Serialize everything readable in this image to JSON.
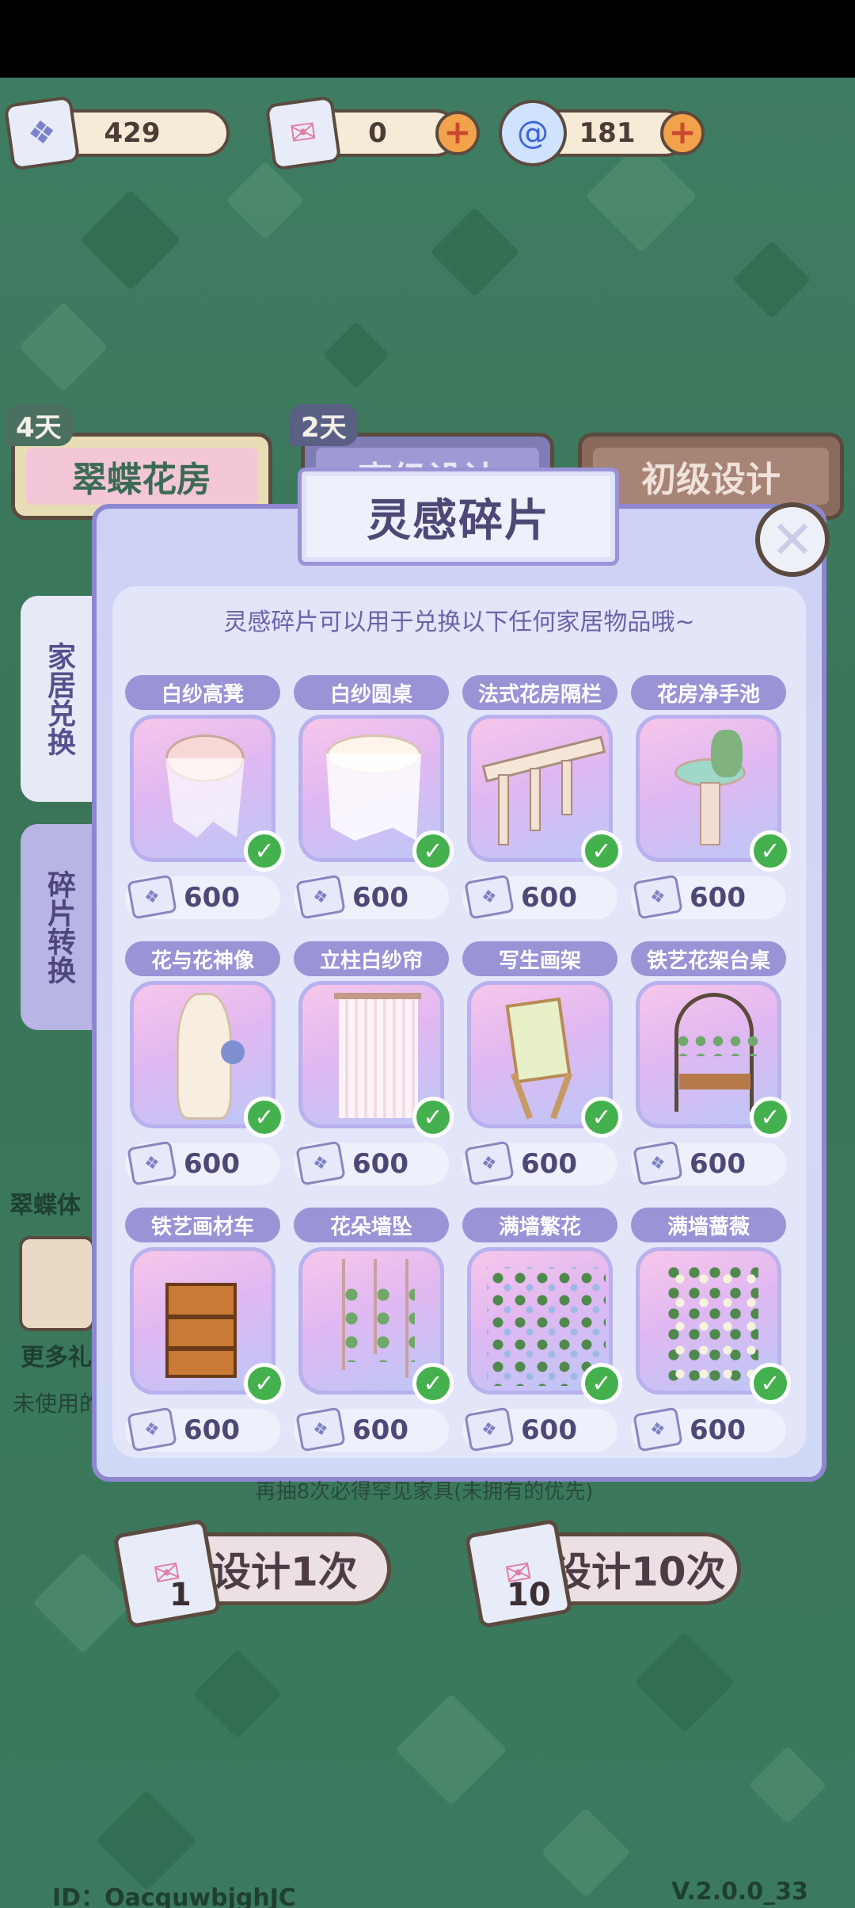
{
  "currencies": [
    {
      "name": "inspiration-fragments",
      "value": "429",
      "icon": "fragment-icon"
    },
    {
      "name": "design-tickets",
      "value": "0",
      "icon": "ticket-icon"
    },
    {
      "name": "swirl-coins",
      "value": "181",
      "icon": "swirl-icon"
    }
  ],
  "tabs": [
    {
      "label": "翠蝶花房",
      "tag": "4天"
    },
    {
      "label": "高级设计",
      "tag": "2天"
    },
    {
      "label": "初级设计"
    }
  ],
  "side_tabs": [
    {
      "label": "家居兑换"
    },
    {
      "label": "碎片转换"
    }
  ],
  "background_partial": {
    "left_label": "翠蝶体",
    "more": "更多礼",
    "unused": "未使用的"
  },
  "modal": {
    "title": "灵感碎片",
    "subtitle": "灵感碎片可以用于兑换以下任何家居物品哦~",
    "items": [
      {
        "name": "白纱高凳",
        "price": "600",
        "owned": true
      },
      {
        "name": "白纱圆桌",
        "price": "600",
        "owned": true
      },
      {
        "name": "法式花房隔栏",
        "price": "600",
        "owned": true
      },
      {
        "name": "花房净手池",
        "price": "600",
        "owned": true
      },
      {
        "name": "花与花神像",
        "price": "600",
        "owned": true
      },
      {
        "name": "立柱白纱帘",
        "price": "600",
        "owned": true
      },
      {
        "name": "写生画架",
        "price": "600",
        "owned": true
      },
      {
        "name": "铁艺花架台桌",
        "price": "600",
        "owned": true
      },
      {
        "name": "铁艺画材车",
        "price": "600",
        "owned": true
      },
      {
        "name": "花朵墙坠",
        "price": "600",
        "owned": true
      },
      {
        "name": "满墙繁花",
        "price": "600",
        "owned": true
      },
      {
        "name": "满墙蔷薇",
        "price": "600",
        "owned": true
      }
    ]
  },
  "bottom": {
    "note": "再抽8次必得罕见家具(未拥有的优先)",
    "draw1_label": "设计1次",
    "draw1_count": "1",
    "draw10_label": "设计10次",
    "draw10_count": "10"
  },
  "footer": {
    "id": "ID：OacquwbjghJC",
    "version": "V.2.0.0_33"
  }
}
